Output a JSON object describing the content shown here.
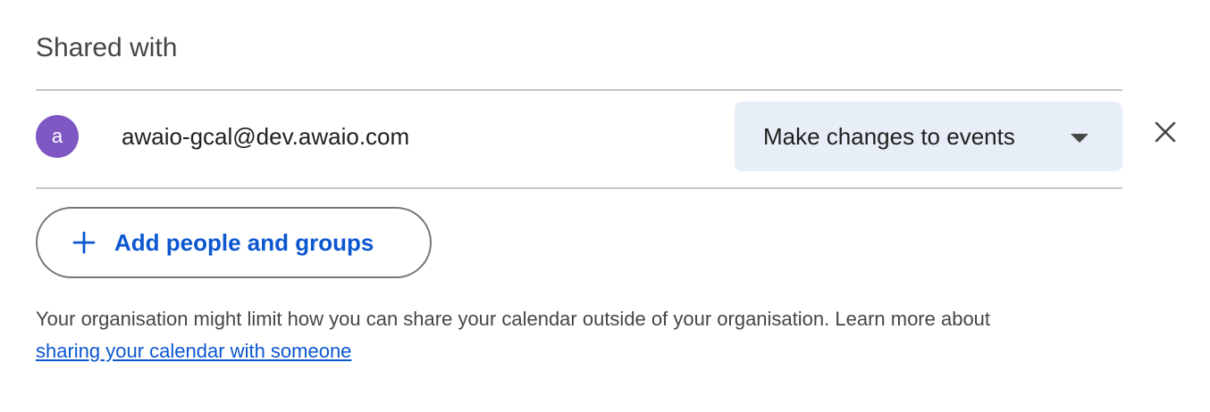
{
  "section": {
    "title": "Shared with"
  },
  "shared_entries": [
    {
      "avatar_initial": "a",
      "avatar_color": "#7e57c2",
      "email": "awaio-gcal@dev.awaio.com",
      "permission": "Make changes to events",
      "permission_icon": "caret-down-icon",
      "remove_icon": "close-icon"
    }
  ],
  "add_button": {
    "label": "Add people and groups",
    "icon": "plus-icon",
    "color": "#0b57d0"
  },
  "info": {
    "text": "Your organisation might limit how you can share your calendar outside of your organisation. Learn more about",
    "link_text": "sharing your calendar with someone"
  },
  "colors": {
    "accent": "#0b57d0",
    "select_background": "#e8eef7",
    "divider": "#c4c7c5"
  }
}
